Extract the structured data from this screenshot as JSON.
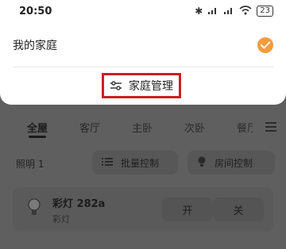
{
  "status_bar": {
    "time": "20:50",
    "battery": "23"
  },
  "home_selector": {
    "current_home": "我的家庭",
    "manage_label": "家庭管理"
  },
  "tabs": [
    "全屋",
    "客厅",
    "主卧",
    "次卧",
    "餐厅"
  ],
  "controls": {
    "lighting_count_label": "照明 1",
    "batch_control": "批量控制",
    "room_control": "房间控制"
  },
  "device": {
    "name": "彩灯 282a",
    "type": "彩灯",
    "on_label": "开",
    "off_label": "关"
  },
  "colors": {
    "accent": "#f39c3d",
    "highlight_border": "#cc1f1f"
  }
}
